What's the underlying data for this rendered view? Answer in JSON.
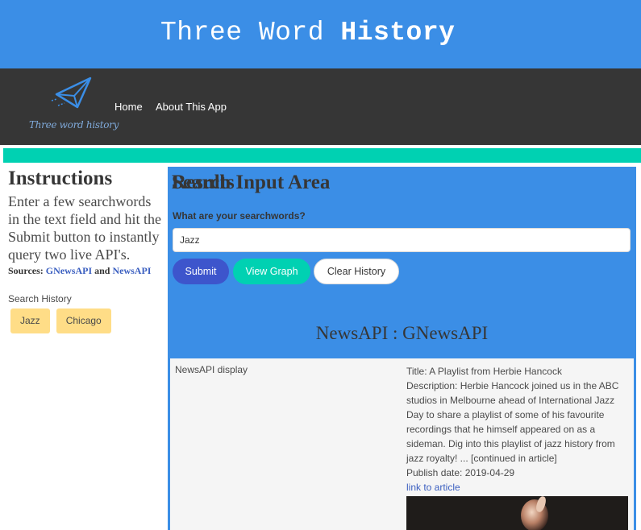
{
  "banner": {
    "title_light": "Three Word ",
    "title_bold": "History"
  },
  "navbar": {
    "logo_text": "Three word history",
    "links": [
      "Home",
      "About This App"
    ]
  },
  "colors": {
    "banner_bg": "#3b8ee6",
    "navbar_bg": "#363636",
    "accent": "#00d1b2",
    "submit": "#3d55cc",
    "tag": "#ffdd87"
  },
  "sidebar": {
    "heading": "Instructions",
    "instructions": "Enter a few searchwords in the text field and hit the Submit button to instantly query two live API's.",
    "sources_label": "Sources:",
    "source_1": "GNewsAPI",
    "sources_and": "and",
    "source_2": "NewsAPI",
    "history_label": "Search History",
    "history": [
      "Jazz",
      "Chicago"
    ]
  },
  "search": {
    "heading": "Search Input Area",
    "field_label": "What are your searchwords?",
    "value": "Jazz",
    "buttons": {
      "submit": "Submit",
      "view_graph": "View Graph",
      "clear_history": "Clear History"
    }
  },
  "results": {
    "heading": "Results",
    "api_title": "NewsAPI : GNewsAPI",
    "display_label": "NewsAPI display",
    "article": {
      "title": "Title: A Playlist from Herbie Hancock",
      "description": "Description: Herbie Hancock joined us in the ABC studios in Melbourne ahead of International Jazz Day to share a playlist of some of his favourite recordings that he himself appeared on as a sideman. Dig into this playlist of jazz history from jazz royalty! ... [continued in article]",
      "publish_date": "Publish date: 2019-04-29",
      "link_text": "link to article"
    }
  }
}
